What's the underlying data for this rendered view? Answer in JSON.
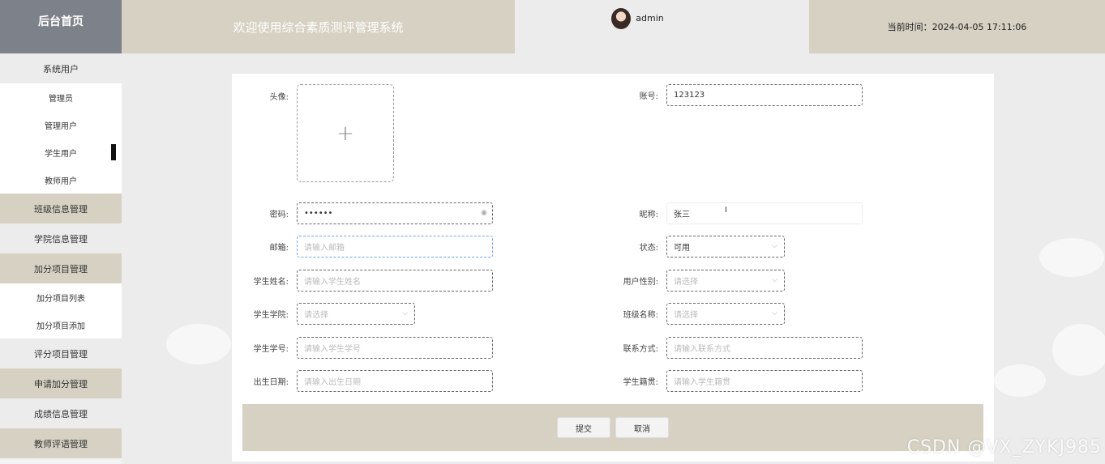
{
  "header": {
    "brand": "后台首页",
    "welcome": "欢迎使用综合素质测评管理系统",
    "username": "admin",
    "time_label": "当前时间：2024-04-05 17:11:06"
  },
  "sidebar": {
    "items": [
      {
        "label": "系统用户",
        "kind": "group-light"
      },
      {
        "label": "管理员",
        "kind": "sub"
      },
      {
        "label": "管理用户",
        "kind": "sub"
      },
      {
        "label": "学生用户",
        "kind": "sub",
        "active": true
      },
      {
        "label": "教师用户",
        "kind": "sub"
      },
      {
        "label": "班级信息管理",
        "kind": "group-dark"
      },
      {
        "label": "学院信息管理",
        "kind": "group-light"
      },
      {
        "label": "加分项目管理",
        "kind": "group-dark"
      },
      {
        "label": "加分项目列表",
        "kind": "sub"
      },
      {
        "label": "加分项目添加",
        "kind": "sub"
      },
      {
        "label": "评分项目管理",
        "kind": "group-light"
      },
      {
        "label": "申请加分管理",
        "kind": "group-dark"
      },
      {
        "label": "成绩信息管理",
        "kind": "group-light"
      },
      {
        "label": "教师评语管理",
        "kind": "group-dark"
      }
    ]
  },
  "form": {
    "avatar_label": "头像:",
    "avatar_upload_icon": "+",
    "account_label": "账号:",
    "account_value": "123123",
    "password_label": "密码:",
    "password_value": "••••••",
    "nickname_label": "昵称:",
    "nickname_value": "张三",
    "email_label": "邮箱:",
    "email_placeholder": "请输入邮箱",
    "status_label": "状态:",
    "status_value": "可用",
    "name_label": "学生姓名:",
    "name_placeholder": "请输入学生姓名",
    "gender_label": "用户性别:",
    "gender_placeholder": "请选择",
    "college_label": "学生学院:",
    "college_placeholder": "请选择",
    "class_label": "班级名称:",
    "class_placeholder": "请选择",
    "student_no_label": "学生学号:",
    "student_no_placeholder": "请输入学生学号",
    "contact_label": "联系方式:",
    "contact_placeholder": "请输入联系方式",
    "birthday_label": "出生日期:",
    "birthday_placeholder": "请输入出生日期",
    "hometown_label": "学生籍贯:",
    "hometown_placeholder": "请输入学生籍贯"
  },
  "actions": {
    "submit": "提交",
    "cancel": "取消"
  },
  "watermark": "CSDN @VX_ZYKJ985",
  "colors": {
    "brand_bg": "#7d8189",
    "accent_bg": "#d6d1c2",
    "page_bg": "#ececec"
  }
}
